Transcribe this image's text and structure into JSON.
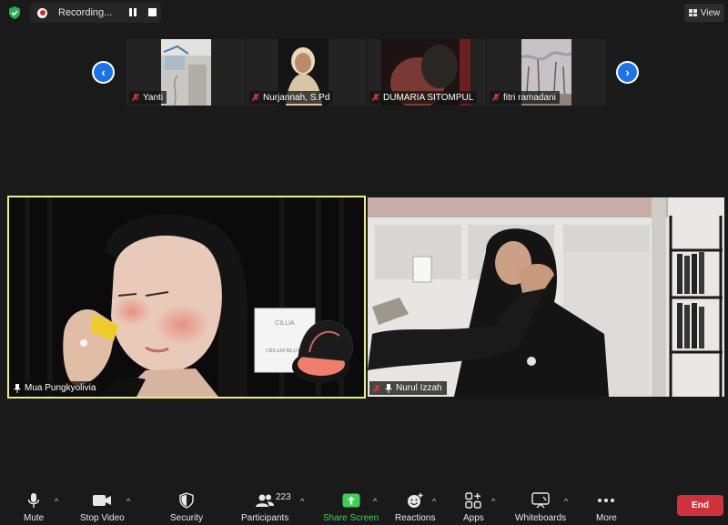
{
  "recording": {
    "label": "Recording..."
  },
  "view": {
    "label": "View"
  },
  "participants_strip": [
    {
      "name": "Yanti",
      "muted": true
    },
    {
      "name": "Nurjannah, S.Pd",
      "muted": true
    },
    {
      "name": "DUMARIA SITOMPUL",
      "muted": true
    },
    {
      "name": "fitri ramadani",
      "muted": true
    }
  ],
  "main_videos": [
    {
      "name": "Mua Pungkyolivia",
      "pinned": true,
      "muted": false,
      "active_speaker": true,
      "product_text": [
        "CILLIA",
        "CREAM BLUSH"
      ]
    },
    {
      "name": "Nurul Izzah",
      "pinned": true,
      "muted": true,
      "active_speaker": false
    }
  ],
  "toolbar": {
    "mute": "Mute",
    "stop_video": "Stop Video",
    "security": "Security",
    "participants": "Participants",
    "participants_count": "223",
    "share_screen": "Share Screen",
    "reactions": "Reactions",
    "apps": "Apps",
    "whiteboards": "Whiteboards",
    "more": "More",
    "end": "End"
  },
  "colors": {
    "background": "#1a1a1a",
    "active_speaker_border": "#e9f080",
    "share_green": "#3ecf5a",
    "end_red": "#d1313b",
    "nav_blue": "#1a73e8",
    "muted_red": "#e0393e"
  }
}
